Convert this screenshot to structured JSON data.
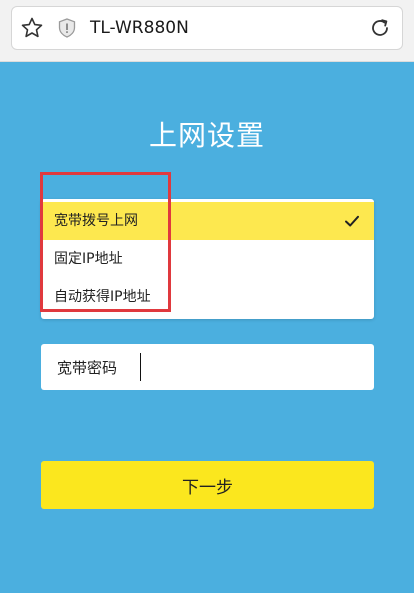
{
  "browser": {
    "url": "TL-WR880N",
    "icons": [
      "star-icon",
      "shield-icon",
      "reload-icon"
    ]
  },
  "page": {
    "title": "上网设置"
  },
  "connection_types": {
    "options": [
      {
        "label": "宽带拨号上网",
        "selected": true
      },
      {
        "label": "固定IP地址",
        "selected": false
      },
      {
        "label": "自动获得IP地址",
        "selected": false
      }
    ],
    "check_icon": "check-icon"
  },
  "password": {
    "label": "宽带密码",
    "value": ""
  },
  "next_button": {
    "label": "下一步"
  },
  "colors": {
    "background": "#4bafdf",
    "selected_option": "#fde84f",
    "button": "#fbe71e",
    "highlight": "#e0393e"
  }
}
